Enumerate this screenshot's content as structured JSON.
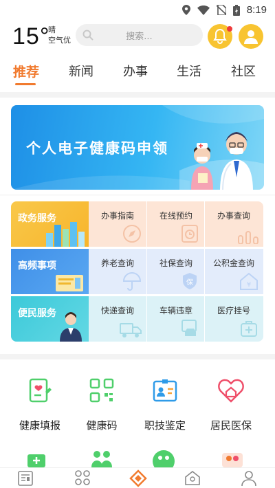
{
  "status_bar": {
    "time": "8:19"
  },
  "header": {
    "temperature": "15°",
    "weather": "晴",
    "air_quality": "空气优",
    "search_placeholder": "搜索..."
  },
  "tabs": [
    {
      "label": "推荐",
      "active": true
    },
    {
      "label": "新闻",
      "active": false
    },
    {
      "label": "办事",
      "active": false
    },
    {
      "label": "生活",
      "active": false
    },
    {
      "label": "社区",
      "active": false
    }
  ],
  "banner": {
    "title": "个人电子健康码申领"
  },
  "services": [
    {
      "category": "政务服务",
      "items": [
        "办事指南",
        "在线预约",
        "办事查询"
      ]
    },
    {
      "category": "高频事项",
      "items": [
        "养老查询",
        "社保查询",
        "公积金查询"
      ]
    },
    {
      "category": "便民服务",
      "items": [
        "快递查询",
        "车辆违章",
        "医疗挂号"
      ]
    }
  ],
  "shortcuts": [
    {
      "label": "健康填报",
      "icon": "health-report-icon"
    },
    {
      "label": "健康码",
      "icon": "qr-code-icon"
    },
    {
      "label": "职技鉴定",
      "icon": "id-card-icon"
    },
    {
      "label": "居民医保",
      "icon": "heart-home-icon"
    }
  ],
  "colors": {
    "accent": "#f17a2e",
    "yellow": "#f8c431",
    "banner_blue": "#1e8fe6"
  }
}
